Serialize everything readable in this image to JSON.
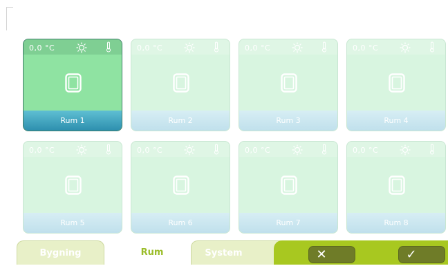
{
  "rooms": [
    {
      "name": "Rum 1",
      "temp": "0,0 °C",
      "active": true
    },
    {
      "name": "Rum 2",
      "temp": "0,0 °C",
      "active": false
    },
    {
      "name": "Rum 3",
      "temp": "0,0 °C",
      "active": false
    },
    {
      "name": "Rum 4",
      "temp": "0,0 °C",
      "active": false
    },
    {
      "name": "Rum 5",
      "temp": "0,0 °C",
      "active": false
    },
    {
      "name": "Rum 6",
      "temp": "0,0 °C",
      "active": false
    },
    {
      "name": "Rum 7",
      "temp": "0,0 °C",
      "active": false
    },
    {
      "name": "Rum 8",
      "temp": "0,0 °C",
      "active": false
    }
  ],
  "tabs": {
    "bygning": "Bygning",
    "rum": "Rum",
    "system": "System"
  },
  "buttons": {
    "cancel_glyph": "✕",
    "ok_glyph": "✓"
  },
  "colors": {
    "active_tile": "#8fe3a2",
    "inactive_tile": "#d8f5e0",
    "accent_green": "#a8c820",
    "button_dark": "#6f7c28"
  }
}
